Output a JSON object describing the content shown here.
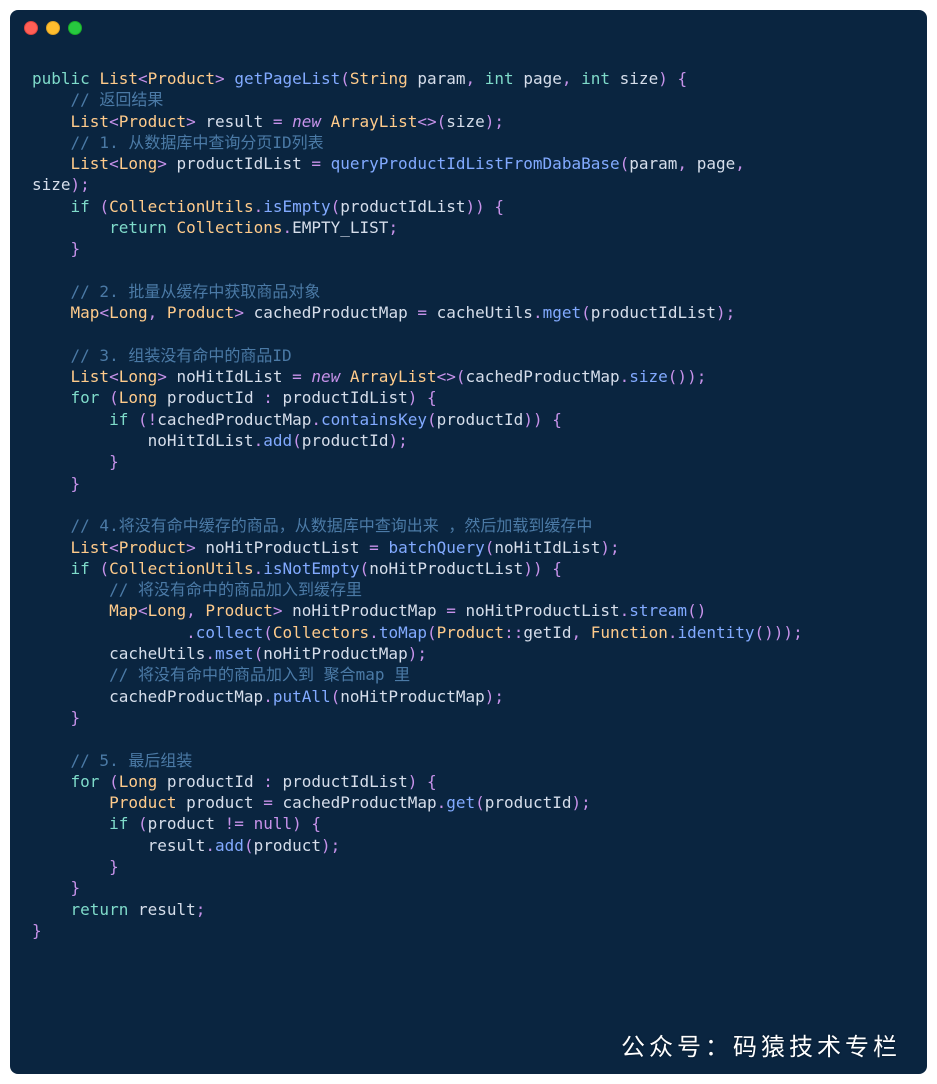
{
  "traffic_lights": [
    "red",
    "yellow",
    "green"
  ],
  "watermark": "公众号：码猿技术专栏",
  "code": {
    "tokens": [
      [
        [
          "kw",
          "public"
        ],
        [
          "plain",
          " "
        ],
        [
          "type",
          "List"
        ],
        [
          "punc",
          "<"
        ],
        [
          "type",
          "Product"
        ],
        [
          "punc",
          "> "
        ],
        [
          "fn",
          "getPageList"
        ],
        [
          "punc",
          "("
        ],
        [
          "type",
          "String"
        ],
        [
          "plain",
          " param"
        ],
        [
          "punc",
          ", "
        ],
        [
          "kw",
          "int"
        ],
        [
          "plain",
          " page"
        ],
        [
          "punc",
          ", "
        ],
        [
          "kw",
          "int"
        ],
        [
          "plain",
          " size"
        ],
        [
          "punc",
          ") {"
        ]
      ],
      [
        [
          "plain",
          "    "
        ],
        [
          "comment",
          "// 返回结果"
        ]
      ],
      [
        [
          "plain",
          "    "
        ],
        [
          "type",
          "List"
        ],
        [
          "punc",
          "<"
        ],
        [
          "type",
          "Product"
        ],
        [
          "punc",
          "> "
        ],
        [
          "plain",
          "result "
        ],
        [
          "punc",
          "= "
        ],
        [
          "new",
          "new "
        ],
        [
          "type",
          "ArrayList"
        ],
        [
          "punc",
          "<>("
        ],
        [
          "plain",
          "size"
        ],
        [
          "punc",
          ");"
        ]
      ],
      [
        [
          "plain",
          "    "
        ],
        [
          "comment",
          "// 1. 从数据库中查询分页ID列表"
        ]
      ],
      [
        [
          "plain",
          "    "
        ],
        [
          "type",
          "List"
        ],
        [
          "punc",
          "<"
        ],
        [
          "type",
          "Long"
        ],
        [
          "punc",
          "> "
        ],
        [
          "plain",
          "productIdList "
        ],
        [
          "punc",
          "= "
        ],
        [
          "fn",
          "queryProductIdListFromDabaBase"
        ],
        [
          "punc",
          "("
        ],
        [
          "plain",
          "param"
        ],
        [
          "punc",
          ", "
        ],
        [
          "plain",
          "page"
        ],
        [
          "punc",
          ", "
        ]
      ],
      [
        [
          "plain",
          "size"
        ],
        [
          "punc",
          ");"
        ]
      ],
      [
        [
          "plain",
          "    "
        ],
        [
          "kw",
          "if"
        ],
        [
          "plain",
          " "
        ],
        [
          "punc",
          "("
        ],
        [
          "type",
          "CollectionUtils"
        ],
        [
          "punc",
          "."
        ],
        [
          "fn",
          "isEmpty"
        ],
        [
          "punc",
          "("
        ],
        [
          "plain",
          "productIdList"
        ],
        [
          "punc",
          ")) {"
        ]
      ],
      [
        [
          "plain",
          "        "
        ],
        [
          "kw",
          "return"
        ],
        [
          "plain",
          " "
        ],
        [
          "type",
          "Collections"
        ],
        [
          "punc",
          "."
        ],
        [
          "plain",
          "EMPTY_LIST"
        ],
        [
          "punc",
          ";"
        ]
      ],
      [
        [
          "plain",
          "    "
        ],
        [
          "punc",
          "}"
        ]
      ],
      [],
      [
        [
          "plain",
          "    "
        ],
        [
          "comment",
          "// 2. 批量从缓存中获取商品对象"
        ]
      ],
      [
        [
          "plain",
          "    "
        ],
        [
          "type",
          "Map"
        ],
        [
          "punc",
          "<"
        ],
        [
          "type",
          "Long"
        ],
        [
          "punc",
          ", "
        ],
        [
          "type",
          "Product"
        ],
        [
          "punc",
          "> "
        ],
        [
          "plain",
          "cachedProductMap "
        ],
        [
          "punc",
          "= "
        ],
        [
          "plain",
          "cacheUtils"
        ],
        [
          "punc",
          "."
        ],
        [
          "fn",
          "mget"
        ],
        [
          "punc",
          "("
        ],
        [
          "plain",
          "productIdList"
        ],
        [
          "punc",
          ");"
        ]
      ],
      [],
      [
        [
          "plain",
          "    "
        ],
        [
          "comment",
          "// 3. 组装没有命中的商品ID"
        ]
      ],
      [
        [
          "plain",
          "    "
        ],
        [
          "type",
          "List"
        ],
        [
          "punc",
          "<"
        ],
        [
          "type",
          "Long"
        ],
        [
          "punc",
          "> "
        ],
        [
          "plain",
          "noHitIdList "
        ],
        [
          "punc",
          "= "
        ],
        [
          "new",
          "new "
        ],
        [
          "type",
          "ArrayList"
        ],
        [
          "punc",
          "<>("
        ],
        [
          "plain",
          "cachedProductMap"
        ],
        [
          "punc",
          "."
        ],
        [
          "fn",
          "size"
        ],
        [
          "punc",
          "());"
        ]
      ],
      [
        [
          "plain",
          "    "
        ],
        [
          "kw",
          "for"
        ],
        [
          "plain",
          " "
        ],
        [
          "punc",
          "("
        ],
        [
          "type",
          "Long"
        ],
        [
          "plain",
          " productId "
        ],
        [
          "punc",
          ": "
        ],
        [
          "plain",
          "productIdList"
        ],
        [
          "punc",
          ") {"
        ]
      ],
      [
        [
          "plain",
          "        "
        ],
        [
          "kw",
          "if"
        ],
        [
          "plain",
          " "
        ],
        [
          "punc",
          "(!"
        ],
        [
          "plain",
          "cachedProductMap"
        ],
        [
          "punc",
          "."
        ],
        [
          "fn",
          "containsKey"
        ],
        [
          "punc",
          "("
        ],
        [
          "plain",
          "productId"
        ],
        [
          "punc",
          ")) {"
        ]
      ],
      [
        [
          "plain",
          "            noHitIdList"
        ],
        [
          "punc",
          "."
        ],
        [
          "fn",
          "add"
        ],
        [
          "punc",
          "("
        ],
        [
          "plain",
          "productId"
        ],
        [
          "punc",
          ");"
        ]
      ],
      [
        [
          "plain",
          "        "
        ],
        [
          "punc",
          "}"
        ]
      ],
      [
        [
          "plain",
          "    "
        ],
        [
          "punc",
          "}"
        ]
      ],
      [],
      [
        [
          "plain",
          "    "
        ],
        [
          "comment",
          "// 4.将没有命中缓存的商品，从数据库中查询出来 ，然后加载到缓存中"
        ]
      ],
      [
        [
          "plain",
          "    "
        ],
        [
          "type",
          "List"
        ],
        [
          "punc",
          "<"
        ],
        [
          "type",
          "Product"
        ],
        [
          "punc",
          "> "
        ],
        [
          "plain",
          "noHitProductList "
        ],
        [
          "punc",
          "= "
        ],
        [
          "fn",
          "batchQuery"
        ],
        [
          "punc",
          "("
        ],
        [
          "plain",
          "noHitIdList"
        ],
        [
          "punc",
          ");"
        ]
      ],
      [
        [
          "plain",
          "    "
        ],
        [
          "kw",
          "if"
        ],
        [
          "plain",
          " "
        ],
        [
          "punc",
          "("
        ],
        [
          "type",
          "CollectionUtils"
        ],
        [
          "punc",
          "."
        ],
        [
          "fn",
          "isNotEmpty"
        ],
        [
          "punc",
          "("
        ],
        [
          "plain",
          "noHitProductList"
        ],
        [
          "punc",
          ")) {"
        ]
      ],
      [
        [
          "plain",
          "        "
        ],
        [
          "comment",
          "// 将没有命中的商品加入到缓存里"
        ]
      ],
      [
        [
          "plain",
          "        "
        ],
        [
          "type",
          "Map"
        ],
        [
          "punc",
          "<"
        ],
        [
          "type",
          "Long"
        ],
        [
          "punc",
          ", "
        ],
        [
          "type",
          "Product"
        ],
        [
          "punc",
          "> "
        ],
        [
          "plain",
          "noHitProductMap "
        ],
        [
          "punc",
          "= "
        ],
        [
          "plain",
          "noHitProductList"
        ],
        [
          "punc",
          "."
        ],
        [
          "fn",
          "stream"
        ],
        [
          "punc",
          "()"
        ]
      ],
      [
        [
          "plain",
          "                "
        ],
        [
          "punc",
          "."
        ],
        [
          "fn",
          "collect"
        ],
        [
          "punc",
          "("
        ],
        [
          "type",
          "Collectors"
        ],
        [
          "punc",
          "."
        ],
        [
          "fn",
          "toMap"
        ],
        [
          "punc",
          "("
        ],
        [
          "type",
          "Product"
        ],
        [
          "punc",
          "::"
        ],
        [
          "plain",
          "getId"
        ],
        [
          "punc",
          ", "
        ],
        [
          "type",
          "Function"
        ],
        [
          "punc",
          "."
        ],
        [
          "fn",
          "identity"
        ],
        [
          "punc",
          "()));"
        ]
      ],
      [
        [
          "plain",
          "        cacheUtils"
        ],
        [
          "punc",
          "."
        ],
        [
          "fn",
          "mset"
        ],
        [
          "punc",
          "("
        ],
        [
          "plain",
          "noHitProductMap"
        ],
        [
          "punc",
          ");"
        ]
      ],
      [
        [
          "plain",
          "        "
        ],
        [
          "comment",
          "// 将没有命中的商品加入到 聚合map 里"
        ]
      ],
      [
        [
          "plain",
          "        cachedProductMap"
        ],
        [
          "punc",
          "."
        ],
        [
          "fn",
          "putAll"
        ],
        [
          "punc",
          "("
        ],
        [
          "plain",
          "noHitProductMap"
        ],
        [
          "punc",
          ");"
        ]
      ],
      [
        [
          "plain",
          "    "
        ],
        [
          "punc",
          "}"
        ]
      ],
      [],
      [
        [
          "plain",
          "    "
        ],
        [
          "comment",
          "// 5. 最后组装"
        ]
      ],
      [
        [
          "plain",
          "    "
        ],
        [
          "kw",
          "for"
        ],
        [
          "plain",
          " "
        ],
        [
          "punc",
          "("
        ],
        [
          "type",
          "Long"
        ],
        [
          "plain",
          " productId "
        ],
        [
          "punc",
          ": "
        ],
        [
          "plain",
          "productIdList"
        ],
        [
          "punc",
          ") {"
        ]
      ],
      [
        [
          "plain",
          "        "
        ],
        [
          "type",
          "Product"
        ],
        [
          "plain",
          " product "
        ],
        [
          "punc",
          "= "
        ],
        [
          "plain",
          "cachedProductMap"
        ],
        [
          "punc",
          "."
        ],
        [
          "fn",
          "get"
        ],
        [
          "punc",
          "("
        ],
        [
          "plain",
          "productId"
        ],
        [
          "punc",
          ");"
        ]
      ],
      [
        [
          "plain",
          "        "
        ],
        [
          "kw",
          "if"
        ],
        [
          "plain",
          " "
        ],
        [
          "punc",
          "("
        ],
        [
          "plain",
          "product "
        ],
        [
          "punc",
          "!= "
        ],
        [
          "null",
          "null"
        ],
        [
          "punc",
          ") {"
        ]
      ],
      [
        [
          "plain",
          "            result"
        ],
        [
          "punc",
          "."
        ],
        [
          "fn",
          "add"
        ],
        [
          "punc",
          "("
        ],
        [
          "plain",
          "product"
        ],
        [
          "punc",
          ");"
        ]
      ],
      [
        [
          "plain",
          "        "
        ],
        [
          "punc",
          "}"
        ]
      ],
      [
        [
          "plain",
          "    "
        ],
        [
          "punc",
          "}"
        ]
      ],
      [
        [
          "plain",
          "    "
        ],
        [
          "kw",
          "return"
        ],
        [
          "plain",
          " result"
        ],
        [
          "punc",
          ";"
        ]
      ],
      [
        [
          "punc",
          "}"
        ]
      ]
    ]
  }
}
